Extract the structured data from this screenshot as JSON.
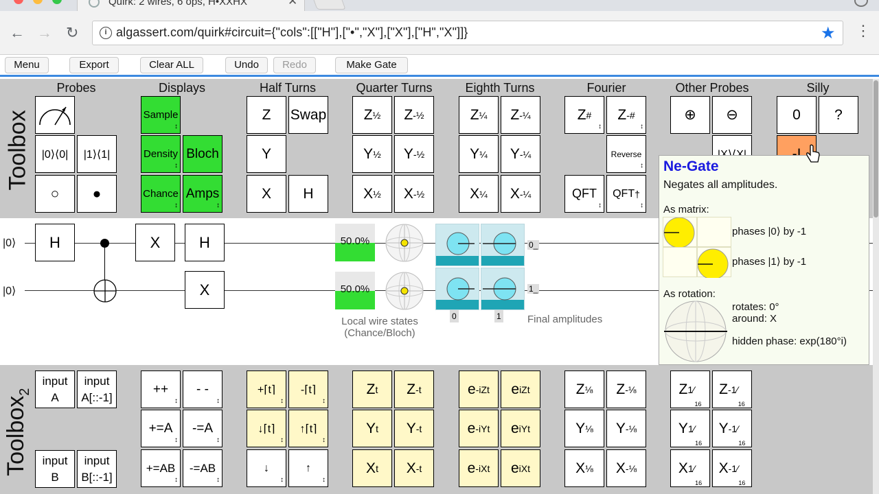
{
  "browser": {
    "tab_title": "Quirk: 2 wires, 6 ops, H•XXHX",
    "tab_close": "✕",
    "url": "algassert.com/quirk#circuit={\"cols\":[[\"H\"],[\"•\",\"X\"],[\"X\"],[\"H\",\"X\"]]}",
    "back": "←",
    "forward": "→",
    "reload": "↻",
    "info": "i",
    "star": "★",
    "menu": "⋮"
  },
  "menubar": {
    "menu": "Menu",
    "export": "Export",
    "clear_all": "Clear ALL",
    "undo": "Undo",
    "redo": "Redo",
    "make_gate": "Make Gate"
  },
  "toolbox1": {
    "label": "Toolbox",
    "groups": {
      "probes": "Probes",
      "displays": "Displays",
      "half_turns": "Half Turns",
      "quarter_turns": "Quarter Turns",
      "eighth_turns": "Eighth Turns",
      "fourier": "Fourier",
      "other_probes": "Other Probes",
      "silly": "Silly"
    },
    "gates": {
      "p0": "|0⟩⟨0|",
      "p1": "|1⟩⟨1|",
      "ctrl_off": "○",
      "ctrl_on": "●",
      "sample": "Sample",
      "density": "Density",
      "bloch": "Bloch",
      "chance": "Chance",
      "amps": "Amps",
      "z": "Z",
      "swap": "Swap",
      "y": "Y",
      "x": "X",
      "h": "H",
      "z_half": "Z",
      "half": "½",
      "neg_half": "-½",
      "quarter": "¼",
      "neg_quarter": "-¼",
      "zsharp": "#",
      "neg_sharp": "-#",
      "reverse": "Reverse",
      "qft": "QFT",
      "dagger": "†",
      "plus_circ": "⊕",
      "minus_circ": "⊖",
      "other2": "|X⟩⟨X|",
      "zero": "0",
      "question": "?",
      "ne": "-I"
    }
  },
  "circuit": {
    "wire0_label": "|0⟩",
    "wire1_label": "|0⟩",
    "gate_h1": "H",
    "gate_x1": "X",
    "gate_h2": "H",
    "gate_x2": "X",
    "prob0": "50.0%",
    "prob1": "50.0%",
    "prob0_value": 0.5,
    "prob1_value": 0.5,
    "amp_out0": "0_",
    "amp_out1": "1_",
    "amp_col0": "0",
    "amp_col1": "1",
    "caption_local": "Local wire states\n(Chance/Bloch)",
    "caption_local1": "Local wire states",
    "caption_local2": "(Chance/Bloch)",
    "caption_final": "Final amplitudes"
  },
  "tooltip": {
    "title": "Ne-Gate",
    "description": "Negates all amplitudes.",
    "as_matrix": "As matrix:",
    "phase0": "phases |0⟩ by -1",
    "phase1": "phases |1⟩ by -1",
    "as_rotation": "As rotation:",
    "rotates": "rotates: 0°",
    "around": "around: X",
    "hidden_phase": "hidden phase: exp(180°i)"
  },
  "toolbox2": {
    "label": "Toolbox",
    "label_sub": "2",
    "gates": {
      "input": "input",
      "a": "A",
      "a_rev": "A[::-1]",
      "b": "B",
      "b_rev": "B[::-1]",
      "inc": "++",
      "dec": "- -",
      "add_a": "+=A",
      "sub_a": "-=A",
      "add_ab": "+=AB",
      "sub_ab": "-=AB",
      "pos_ft": "+⌈t⌉",
      "neg_ft": "-⌈t⌉",
      "down_ft": "↓⌈t⌉",
      "up_ft": "↑⌈t⌉",
      "down": "↓",
      "up": "↑",
      "t": "t",
      "neg_t": "-t",
      "e": "e",
      "iz": "-iZt",
      "iz_pos": "iZt",
      "iy": "-iYt",
      "iy_pos": "iYt",
      "ix": "-iXt",
      "ix_pos": "iXt",
      "eighth": "⅛",
      "neg_eighth": "-⅛",
      "sixteenth": "1⁄",
      "neg_sixteenth": "-1⁄",
      "sixteen": "16"
    }
  }
}
